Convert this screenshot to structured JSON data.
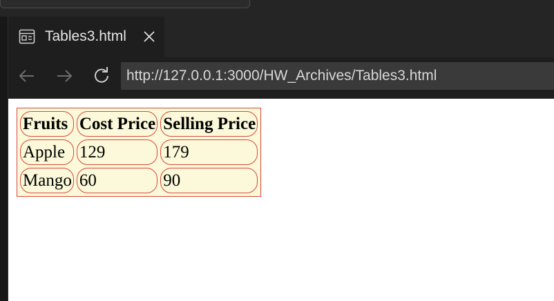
{
  "tab": {
    "title": "Tables3.html",
    "icon": "preview-icon"
  },
  "nav": {
    "url": "http://127.0.0.1:3000/HW_Archives/Tables3.html"
  },
  "table": {
    "headers": [
      "Fruits",
      "Cost Price",
      "Selling Price"
    ],
    "rows": [
      [
        "Apple",
        "129",
        "179"
      ],
      [
        "Mango",
        "60",
        "90"
      ]
    ]
  },
  "colors": {
    "table_border": "#d9463a",
    "table_bg": "#fbf9d9",
    "chrome_bg": "#1e1e1e"
  }
}
